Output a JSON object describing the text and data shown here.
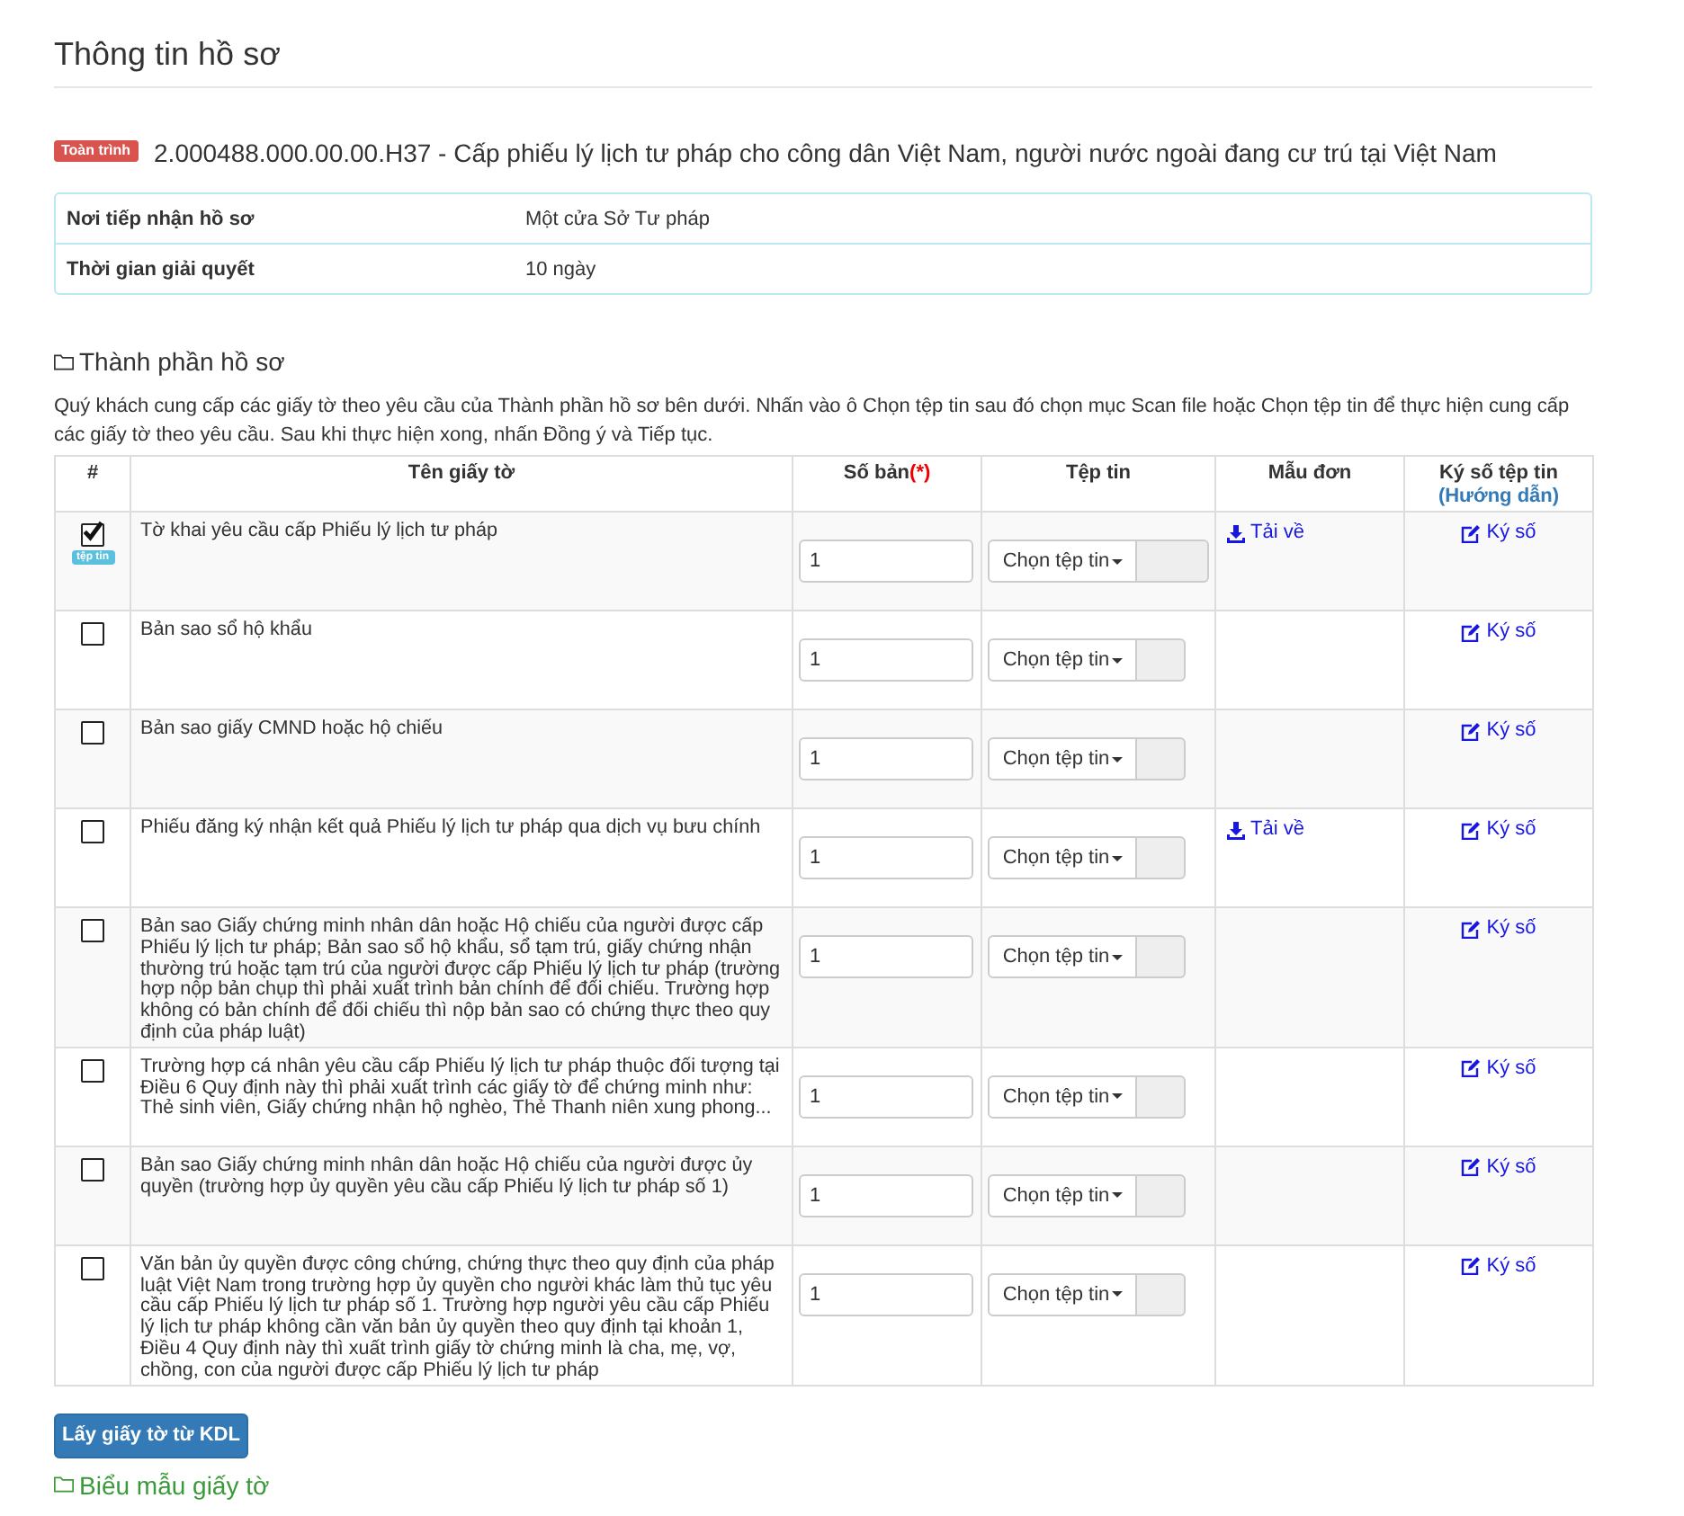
{
  "header": {
    "title": "Thông tin hồ sơ"
  },
  "procedure": {
    "badge": "Toàn trình",
    "title": "2.000488.000.00.00.H37 - Cấp phiếu lý lịch tư pháp cho công dân Việt Nam, người nước ngoài đang cư trú tại Việt Nam"
  },
  "info": [
    {
      "label": "Nơi tiếp nhận hồ sơ",
      "value": "Một cửa Sở Tư pháp"
    },
    {
      "label": "Thời gian giải quyết",
      "value": "10 ngày"
    }
  ],
  "documents": {
    "heading": "Thành phần hồ sơ",
    "instructions": "Quý khách cung cấp các giấy tờ theo yêu cầu của Thành phần hồ sơ bên dưới. Nhấn vào ô Chọn tệp tin sau đó chọn mục Scan file hoặc Chọn tệp tin để thực hiện cung cấp các giấy tờ theo yêu cầu. Sau khi thực hiện xong, nhấn Đồng ý và Tiếp tục.",
    "columns": [
      {
        "label": "#"
      },
      {
        "label": "Tên giấy tờ"
      },
      {
        "label": "Số bản",
        "required_mark": "(*)"
      },
      {
        "label": "Tệp tin"
      },
      {
        "label": "Mẫu đơn"
      },
      {
        "label": "Ký số tệp tin",
        "link": "(Hướng dẫn)"
      }
    ],
    "rows": [
      {
        "checked": true,
        "file_badge": "tệp tin",
        "name": "Tờ khai yêu cầu cấp Phiếu lý lịch tư pháp",
        "copies": "1",
        "file_button": "Chọn tệp tin",
        "template_link": "Tải về",
        "sign_link": "Ký số"
      },
      {
        "checked": false,
        "name": "Bản sao sổ hộ khẩu",
        "copies": "1",
        "file_button": "Chọn tệp tin",
        "sign_link": "Ký số"
      },
      {
        "checked": false,
        "name": "Bản sao giấy CMND hoặc hộ chiếu",
        "copies": "1",
        "file_button": "Chọn tệp tin",
        "sign_link": "Ký số"
      },
      {
        "checked": false,
        "name": "Phiếu đăng ký nhận kết quả Phiếu lý lịch tư pháp qua dịch vụ bưu chính",
        "copies": "1",
        "file_button": "Chọn tệp tin",
        "template_link": "Tải về",
        "sign_link": "Ký số"
      },
      {
        "checked": false,
        "name": "Bản sao Giấy chứng minh nhân dân hoặc Hộ chiếu của người được cấp Phiếu lý lịch tư pháp; Bản sao sổ hộ khẩu, sổ tạm trú, giấy chứng nhận thường trú hoặc tạm trú của người được cấp Phiếu lý lịch tư pháp (trường hợp nộp bản chụp thì phải xuất trình bản chính để đối chiếu. Trường hợp không có bản chính để đối chiếu thì nộp bản sao có chứng thực theo quy định của pháp luật)",
        "copies": "1",
        "file_button": "Chọn tệp tin",
        "sign_link": "Ký số"
      },
      {
        "checked": false,
        "name": "Trường hợp cá nhân yêu cầu cấp Phiếu lý lịch tư pháp thuộc đối tượng tại Điều 6 Quy định này thì phải xuất trình các giấy tờ để chứng minh như: Thẻ sinh viên, Giấy chứng nhận hộ nghèo, Thẻ Thanh niên xung phong...",
        "copies": "1",
        "file_button": "Chọn tệp tin",
        "sign_link": "Ký số"
      },
      {
        "checked": false,
        "name": "Bản sao Giấy chứng minh nhân dân hoặc Hộ chiếu của người được ủy quyền (trường hợp ủy quyền yêu cầu cấp Phiếu lý lịch tư pháp số 1)",
        "copies": "1",
        "file_button": "Chọn tệp tin",
        "sign_link": "Ký số"
      },
      {
        "checked": false,
        "name": "Văn bản ủy quyền được công chứng, chứng thực theo quy định của pháp luật Việt Nam trong trường hợp ủy quyền cho người khác làm thủ tục yêu cầu cấp Phiếu lý lịch tư pháp số 1. Trường hợp người yêu cầu cấp Phiếu lý lịch tư pháp không cần văn bản ủy quyền theo quy định tại khoản 1, Điều 4 Quy định này thì xuất trình giấy tờ chứng minh là cha, mẹ, vợ, chồng, con của người được cấp Phiếu lý lịch tư pháp",
        "copies": "1",
        "file_button": "Chọn tệp tin",
        "sign_link": "Ký số"
      }
    ]
  },
  "actions": {
    "fetch_button": "Lấy giấy tờ từ KDL",
    "templates_link": "Biểu mẫu giấy tờ"
  }
}
